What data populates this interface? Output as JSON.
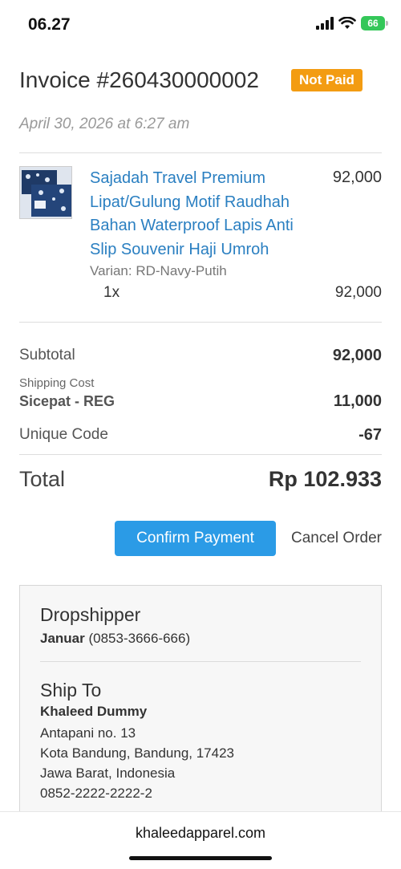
{
  "status_bar": {
    "time": "06.27",
    "battery": "66"
  },
  "invoice": {
    "title": "Invoice #260430000002",
    "status": "Not Paid",
    "date": "April 30, 2026 at 6:27 am"
  },
  "product": {
    "name": "Sajadah Travel Premium Lipat/Gulung Motif Raudhah Bahan Waterproof Lapis Anti Slip Souvenir Haji Umroh",
    "price": "92,000",
    "variant": "Varian: RD-Navy-Putih",
    "quantity": "1x",
    "line_total": "92,000"
  },
  "summary": {
    "subtotal_label": "Subtotal",
    "subtotal_value": "92,000",
    "shipping_label": "Shipping Cost",
    "shipping_method": "Sicepat - REG",
    "shipping_value": "11,000",
    "unique_code_label": "Unique Code",
    "unique_code_value": "-67",
    "total_label": "Total",
    "total_value": "Rp 102.933"
  },
  "actions": {
    "confirm_label": "Confirm Payment",
    "cancel_label": "Cancel Order"
  },
  "dropshipper": {
    "heading": "Dropshipper",
    "name": "Januar",
    "phone": "(0853-3666-666)"
  },
  "ship_to": {
    "heading": "Ship To",
    "name": "Khaleed Dummy",
    "address_line1": "Antapani no. 13",
    "address_line2": "Kota Bandung, Bandung, 17423",
    "address_line3": "Jawa Barat, Indonesia",
    "phone": "0852-2222-2222-2"
  },
  "browser": {
    "url": "khaleedapparel.com"
  },
  "colors": {
    "link": "#2a7fc1",
    "badge": "#f39c12",
    "button": "#2b9be6",
    "battery": "#34c759"
  }
}
